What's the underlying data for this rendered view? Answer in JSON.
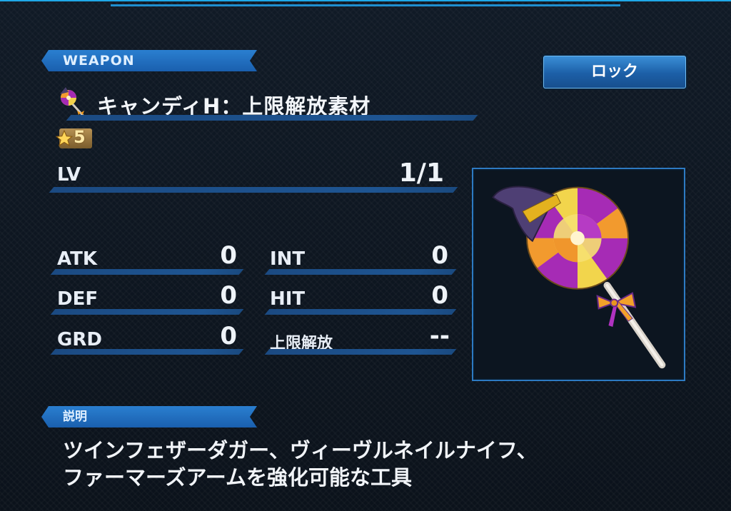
{
  "section_weapon": "WEAPON",
  "lock_button": "ロック",
  "item": {
    "name": "キャンディH：上限解放素材",
    "icon": "lollipop-icon",
    "rarity": "5"
  },
  "level": {
    "label": "LV",
    "value": "1/1"
  },
  "stats": [
    {
      "label": "ATK",
      "value": "0"
    },
    {
      "label": "INT",
      "value": "0"
    },
    {
      "label": "DEF",
      "value": "0"
    },
    {
      "label": "HIT",
      "value": "0"
    },
    {
      "label": "GRD",
      "value": "0"
    },
    {
      "label": "上限解放",
      "value": "--"
    }
  ],
  "section_description": "説明",
  "description": {
    "line1": "ツインフェザーダガー、ヴィーヴルネイルナイフ、",
    "line2": "ファーマーズアームを強化可能な工具"
  },
  "colors": {
    "accent": "#1f6fc0",
    "background": "#0d1520"
  }
}
